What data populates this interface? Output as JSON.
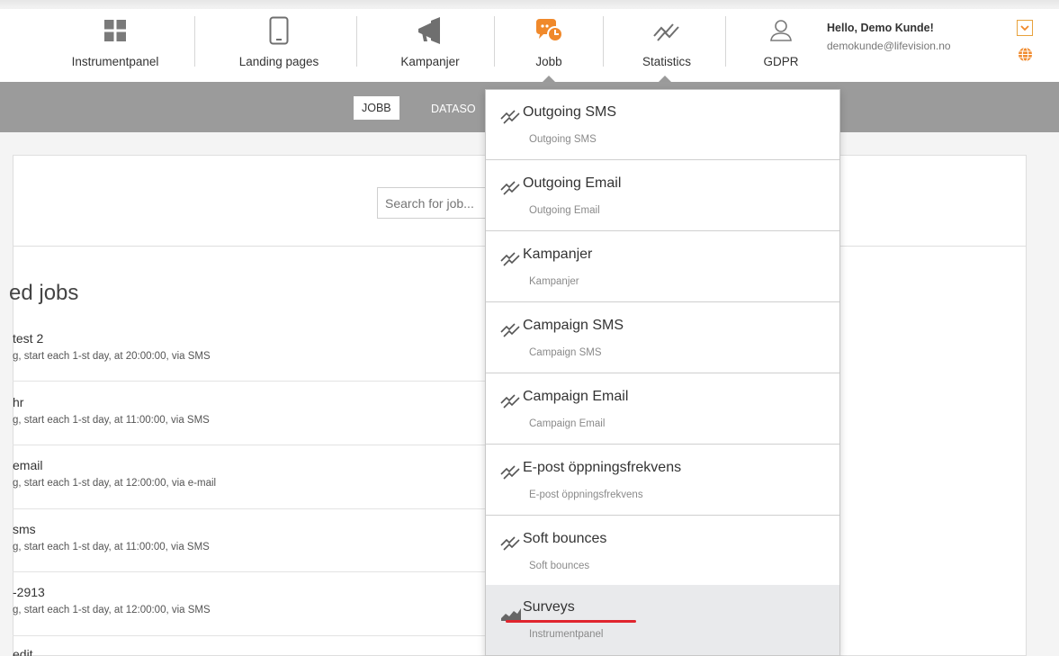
{
  "nav": {
    "items": [
      {
        "label": "Instrumentpanel",
        "icon": "dashboard-icon"
      },
      {
        "label": "Landing pages",
        "icon": "mobile-phone-icon"
      },
      {
        "label": "Kampanjer",
        "icon": "megaphone-icon"
      },
      {
        "label": "Jobb",
        "icon": "chat-clock-icon"
      },
      {
        "label": "Statistics",
        "icon": "line-chart-icon"
      },
      {
        "label": "GDPR",
        "icon": "user-icon"
      }
    ],
    "accent_color": "#f0892b"
  },
  "user": {
    "greeting": "Hello, Demo Kunde!",
    "email": "demokunde@lifevision.no"
  },
  "subnav": {
    "active": "JOBB",
    "link": "DATASO"
  },
  "search": {
    "placeholder": "Search for job..."
  },
  "section": {
    "title": "ed jobs"
  },
  "jobs": [
    {
      "title": "test 2",
      "desc": "g, start each 1-st day, at 20:00:00, via SMS"
    },
    {
      "title": "hr",
      "desc": "g, start each 1-st day, at 11:00:00, via SMS"
    },
    {
      "title": "email",
      "desc": "g, start each 1-st day, at 12:00:00, via e-mail"
    },
    {
      "title": "sms",
      "desc": "g, start each 1-st day, at 11:00:00, via SMS"
    },
    {
      "title": "-2913",
      "desc": "g, start each 1-st day, at 12:00:00, via SMS"
    },
    {
      "title": "edit",
      "desc": ""
    }
  ],
  "dropdown": {
    "items": [
      {
        "title": "Outgoing SMS",
        "subtitle": "Outgoing SMS",
        "icon": "line-chart-icon"
      },
      {
        "title": "Outgoing Email",
        "subtitle": "Outgoing Email",
        "icon": "line-chart-icon"
      },
      {
        "title": "Kampanjer",
        "subtitle": "Kampanjer",
        "icon": "line-chart-icon"
      },
      {
        "title": "Campaign SMS",
        "subtitle": "Campaign SMS",
        "icon": "line-chart-icon"
      },
      {
        "title": "Campaign Email",
        "subtitle": "Campaign Email",
        "icon": "line-chart-icon"
      },
      {
        "title": "E-post öppningsfrekvens",
        "subtitle": "E-post öppningsfrekvens",
        "icon": "line-chart-icon"
      },
      {
        "title": "Soft bounces",
        "subtitle": "Soft bounces",
        "icon": "line-chart-icon"
      },
      {
        "title": "Surveys",
        "subtitle": "Instrumentpanel",
        "icon": "area-chart-icon"
      }
    ],
    "highlight_color": "#e0252e"
  }
}
